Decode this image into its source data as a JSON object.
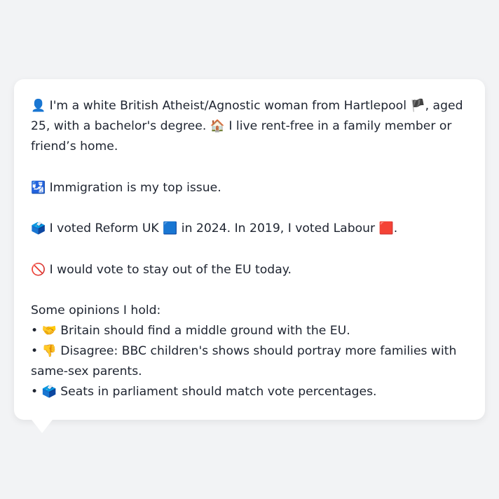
{
  "bio": {
    "intro": {
      "person_icon": "👤",
      "text_1": "I'm a white British Atheist/Agnostic woman from Hartlepool",
      "flag": "🏴",
      "text_2": ", aged 25, with a bachelor's degree.",
      "home_icon": "🏠",
      "text_3": "I live rent-free in a family member or friend’s home."
    },
    "issue": {
      "icon": "🛂",
      "text": "Immigration is my top issue."
    },
    "vote": {
      "ballot_icon": "🗳️",
      "text_1": "I voted Reform UK",
      "reform_square": "🟦",
      "text_2": "in 2024. In 2019, I voted Labour",
      "labour_square": "🟥",
      "text_3": "."
    },
    "eu": {
      "icon": "🚫",
      "text": "I would vote to stay out of the EU today."
    },
    "opinions": {
      "heading": "Some opinions I hold:",
      "items": [
        {
          "bullet": "•",
          "icon": "🤝",
          "text": "Britain should find a middle ground with the EU."
        },
        {
          "bullet": "•",
          "icon": "👎",
          "text": "Disagree: BBC children's shows should portray more families with same-sex parents."
        },
        {
          "bullet": "•",
          "icon": "🗳️",
          "text": "Seats in parliament should match vote percentages."
        }
      ]
    }
  }
}
